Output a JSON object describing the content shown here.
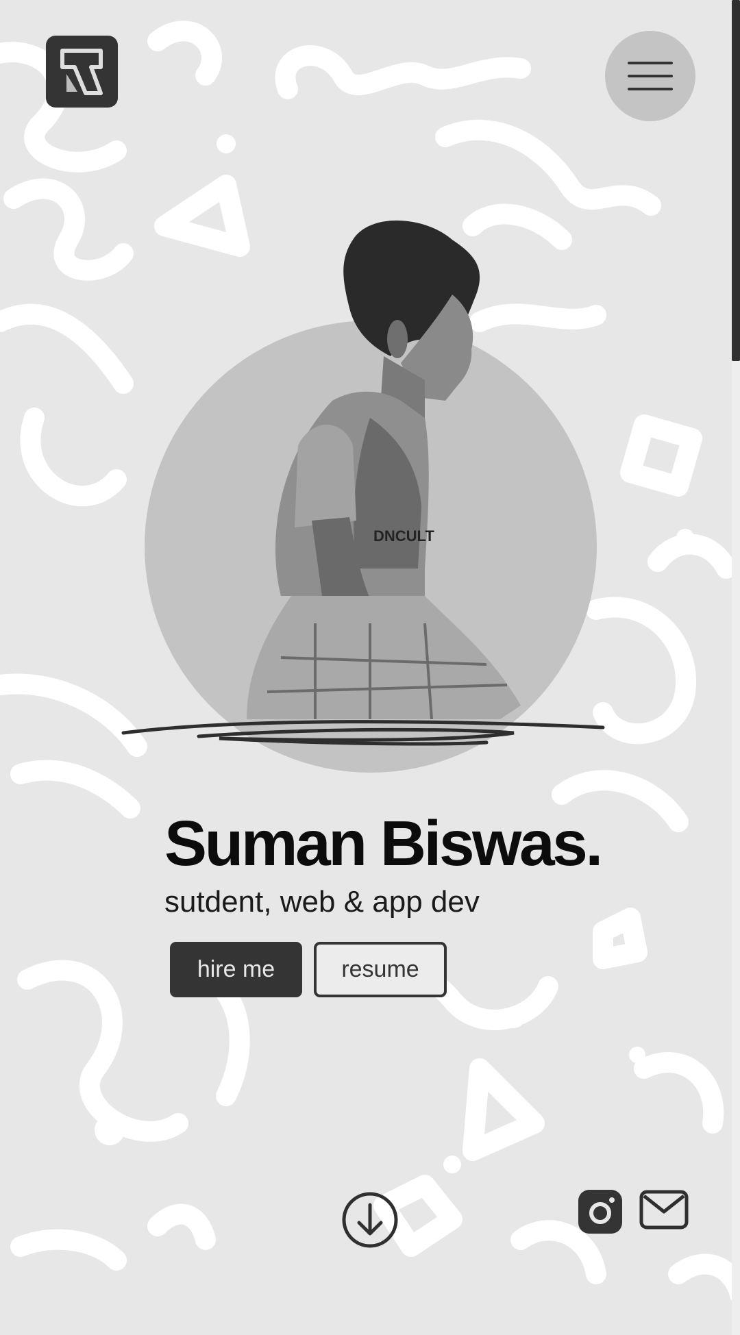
{
  "header": {
    "logo_icon": "brand-logo-icon",
    "menu_icon": "hamburger-menu-icon"
  },
  "hero": {
    "name": "Suman Biswas.",
    "tagline": "sutdent, web & app dev",
    "hire_label": "hire me",
    "resume_label": "resume"
  },
  "footer": {
    "scroll_icon": "arrow-down-circle-icon",
    "social": [
      {
        "icon": "instagram-icon"
      },
      {
        "icon": "mail-icon"
      }
    ]
  },
  "colors": {
    "background": "#e7e7e7",
    "doodle": "#ffffff",
    "accent_dark": "#343434",
    "circle": "#c3c3c3"
  }
}
